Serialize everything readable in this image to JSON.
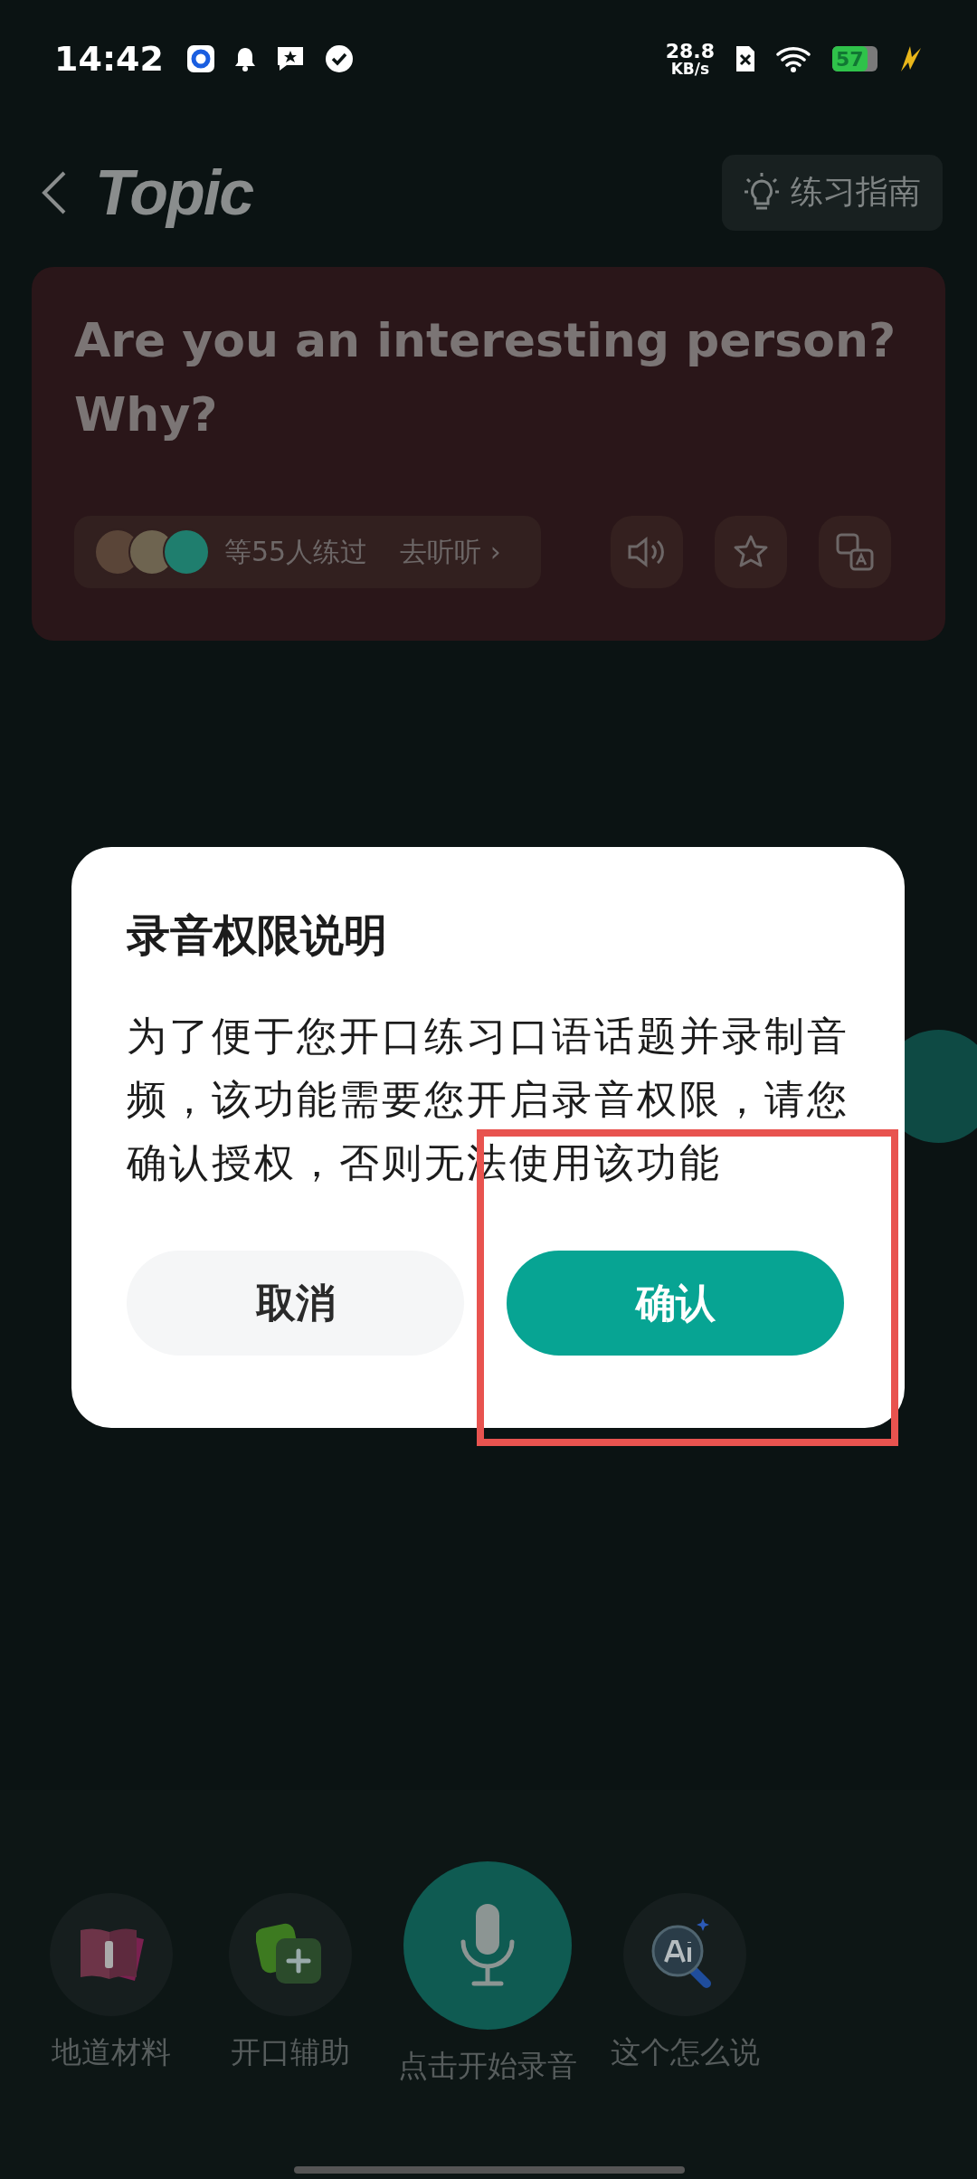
{
  "status_bar": {
    "time": "14:42",
    "net_speed": "28.8",
    "net_unit": "KB/s",
    "battery": "57"
  },
  "header": {
    "title": "Topic",
    "guide_button": "练习指南"
  },
  "topic_card": {
    "question": "Are you an interesting person? Why?",
    "practiced": "等55人练过",
    "listen_link": "去听听",
    "listen_arrow": "›"
  },
  "dialog": {
    "title": "录音权限说明",
    "body": "为了便于您开口练习口语话题并录制音频，该功能需要您开启录音权限，请您确认授权，否则无法使用该功能",
    "buttons": [
      {
        "label": "取消",
        "kind": "secondary"
      },
      {
        "label": "确认",
        "kind": "primary"
      }
    ]
  },
  "annotation": {
    "kind": "highlight-frame"
  },
  "toolbar": {
    "items": [
      {
        "label": "地道材料",
        "kind": "book"
      },
      {
        "label": "开口辅助",
        "kind": "assist"
      },
      {
        "label": "点击开始录音",
        "kind": "record"
      },
      {
        "label": "这个怎么说",
        "kind": "ai"
      }
    ]
  }
}
